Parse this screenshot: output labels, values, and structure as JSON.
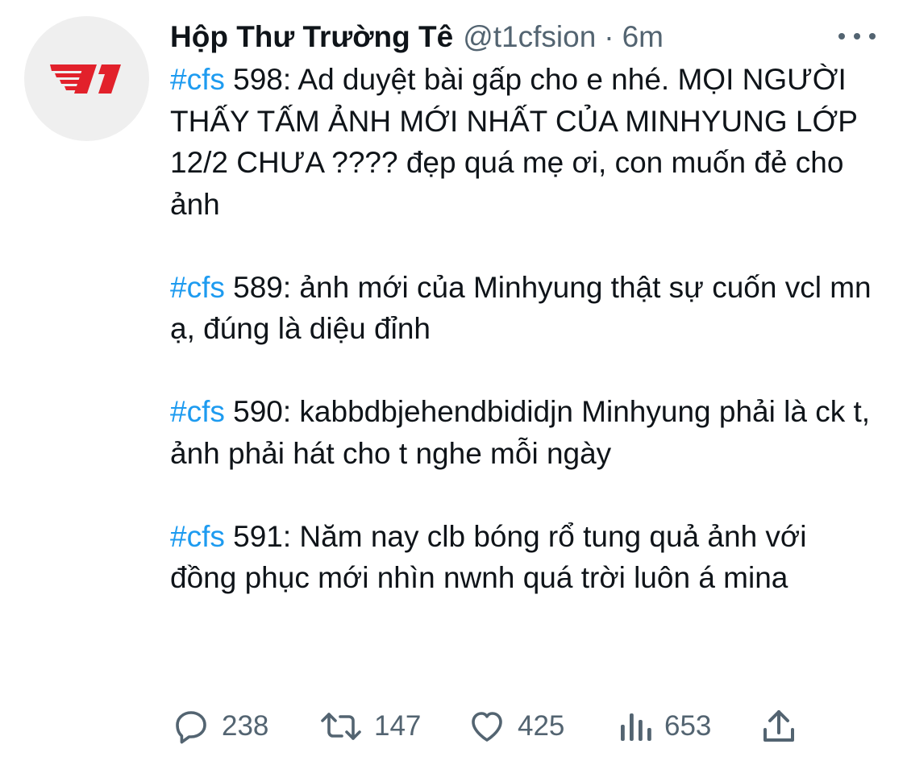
{
  "tweet": {
    "display_name": "Hộp Thư Trường Tê",
    "handle": "@t1cfsion",
    "separator": "·",
    "time": "6m",
    "avatar_icon": "t1-logo-icon",
    "avatar_color": "#e2212b",
    "hashtag_color": "#1d9bf0",
    "paragraphs": [
      {
        "hashtag": "#cfs",
        "text": " 598: Ad duyệt bài gấp cho e nhé. MỌI NGƯỜI THẤY TẤM ẢNH MỚI NHẤT CỦA MINHYUNG LỚP 12/2 CHƯA ???? đẹp quá mẹ ơi, con muốn đẻ cho ảnh"
      },
      {
        "hashtag": "#cfs",
        "text": " 589: ảnh mới của Minhyung thật sự cuốn vcl mn ạ, đúng là diệu đỉnh"
      },
      {
        "hashtag": "#cfs",
        "text": " 590: kabbdbjehendbididjn Minhyung phải là ck t, ảnh phải hát cho t nghe mỗi ngày"
      },
      {
        "hashtag": "#cfs",
        "text": " 591: Năm nay clb bóng rổ tung quả ảnh với đồng phục mới nhìn nwnh quá trời luôn á mina"
      }
    ]
  },
  "actions": {
    "reply": {
      "icon": "reply-icon",
      "count": "238"
    },
    "retweet": {
      "icon": "retweet-icon",
      "count": "147"
    },
    "like": {
      "icon": "heart-icon",
      "count": "425"
    },
    "views": {
      "icon": "views-icon",
      "count": "653"
    },
    "share": {
      "icon": "share-icon"
    }
  },
  "more_icon": "more-icon"
}
